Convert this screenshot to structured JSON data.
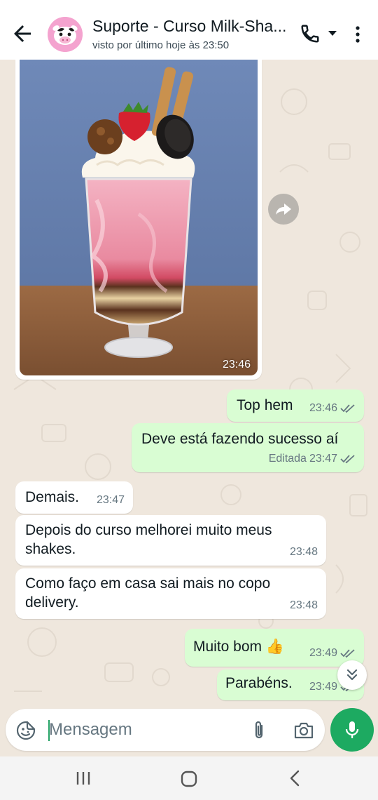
{
  "header": {
    "contact_name": "Suporte - Curso Milk-Sha...",
    "last_seen": "visto por último hoje às 23:50"
  },
  "messages": [
    {
      "id": "img",
      "direction": "in",
      "type": "image",
      "time": "23:46"
    },
    {
      "id": "m1",
      "direction": "out",
      "text": "Top hem",
      "time": "23:46",
      "status": "read"
    },
    {
      "id": "m2",
      "direction": "out",
      "text": "Deve está fazendo sucesso aí",
      "edited_label": "Editada",
      "time": "23:47",
      "status": "read"
    },
    {
      "id": "m3",
      "direction": "in",
      "text": "Demais.",
      "time": "23:47"
    },
    {
      "id": "m4",
      "direction": "in",
      "text": "Depois do curso melhorei muito meus shakes.",
      "time": "23:48"
    },
    {
      "id": "m5",
      "direction": "in",
      "text": "Como faço em casa sai mais no copo delivery.",
      "time": "23:48"
    },
    {
      "id": "m6",
      "direction": "out",
      "text": "Muito bom 👍",
      "time": "23:49",
      "status": "read"
    },
    {
      "id": "m7",
      "direction": "out",
      "text": "Parabéns.",
      "time": "23:49",
      "status": "read"
    }
  ],
  "composer": {
    "placeholder": "Mensagem"
  },
  "icons": {
    "back": "arrow-left-icon",
    "call": "phone-icon",
    "menu": "more-vertical-icon",
    "forward": "forward-icon",
    "scroll": "double-chevron-down-icon",
    "sticker": "sticker-icon",
    "attach": "paperclip-icon",
    "camera": "camera-icon",
    "mic": "microphone-icon"
  },
  "colors": {
    "outgoing_bubble": "#d9fdd3",
    "incoming_bubble": "#ffffff",
    "chat_background": "#efe7dd",
    "accent_green": "#1daa61",
    "read_ticks": "#667781"
  }
}
